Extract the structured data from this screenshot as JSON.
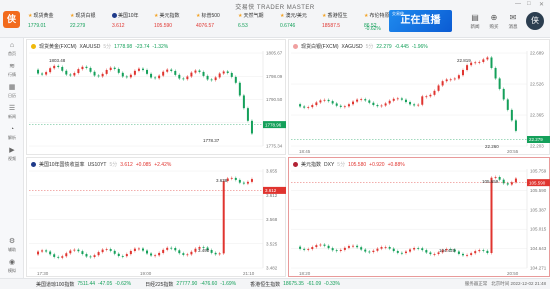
{
  "app": {
    "title": "交易侠 TRADER MASTER",
    "logo": "侠"
  },
  "window_controls": [
    "—",
    "□",
    "✕"
  ],
  "tickers": [
    {
      "name": "现货黄金",
      "value": "1779.01",
      "dir": "dn",
      "icon": "star-icon"
    },
    {
      "name": "现货白银",
      "value": "22.279",
      "dir": "dn",
      "icon": "star-icon"
    },
    {
      "name": "美国10年",
      "value": "3.612",
      "dir": "up",
      "icon": "us-flag-icon"
    },
    {
      "name": "美元指数",
      "value": "105.590",
      "dir": "up",
      "icon": "star-icon"
    },
    {
      "name": "标普500",
      "value": "4076.57",
      "dir": "up",
      "icon": "star-icon"
    },
    {
      "name": "天然气期",
      "value": "6.53",
      "dir": "dn",
      "icon": "star-icon"
    },
    {
      "name": "澳元/美元",
      "value": "0.6746",
      "dir": "dn",
      "icon": "star-icon"
    },
    {
      "name": "香港恒生",
      "value": "18587.5",
      "dir": "up",
      "icon": "star-icon"
    },
    {
      "name": "布伦特原油",
      "value": "86.52",
      "dir": "dn",
      "icon": "star-icon"
    },
    {
      "name": "",
      "value": "-0.62%",
      "dir": "dn",
      "icon": ""
    }
  ],
  "banner": {
    "main": "正在直播",
    "sub": "交易侠"
  },
  "top_icons": [
    {
      "name": "news-icon",
      "label": "新闻",
      "glyph": "▤"
    },
    {
      "name": "cart-icon",
      "label": "购买",
      "glyph": "⊕"
    },
    {
      "name": "message-icon",
      "label": "消息",
      "glyph": "✉"
    }
  ],
  "avatar": "侠",
  "sidebar": [
    {
      "icon": "home-icon",
      "glyph": "⌂",
      "label": "首页"
    },
    {
      "icon": "quotes-icon",
      "glyph": "≋",
      "label": "行情"
    },
    {
      "icon": "calendar-icon",
      "glyph": "▦",
      "label": "日历"
    },
    {
      "icon": "news-icon",
      "glyph": "☰",
      "label": "新闻"
    },
    {
      "icon": "analysis-icon",
      "glyph": "◔",
      "label": "解析"
    },
    {
      "icon": "video-icon",
      "glyph": "▶",
      "label": "视频"
    },
    {
      "icon": "tools-icon",
      "glyph": "⚙",
      "label": "辅助"
    },
    {
      "icon": "simulate-icon",
      "glyph": "◉",
      "label": "模拟"
    }
  ],
  "panels": [
    {
      "id": "gold",
      "name": "现货黄金(FXCM)",
      "symbol": "XAUUSD",
      "timeframe": "5分",
      "price": "1778.98",
      "change": "-23.74",
      "pct": "-1.32%",
      "dir": "dn",
      "flagcolor": "#f0b90b",
      "yticks": [
        "1805.67",
        "1798.09",
        "1790.50",
        "1782.92",
        "1775.34"
      ],
      "xticks": [],
      "last_label": "1778.96",
      "hi_label": "1803.48",
      "lo_label": "1778.37"
    },
    {
      "id": "silver",
      "name": "现货白银(FXCM)",
      "symbol": "XAGUSD",
      "timeframe": "5分",
      "price": "22.279",
      "change": "-0.445",
      "pct": "-1.96%",
      "dir": "dn",
      "flagcolor": "#c0c0c0",
      "yticks": [
        "22.689",
        "22.526",
        "22.365",
        "22.203"
      ],
      "xticks": [
        "18:45",
        "20:55"
      ],
      "last_label": "22.279",
      "hi_label": "22.819",
      "lo_label": "22.260"
    },
    {
      "id": "us10y",
      "name": "美国10年国债收益率",
      "symbol": "US10YT",
      "timeframe": "5分",
      "price": "3.612",
      "change": "+0.085",
      "pct": "+2.42%",
      "dir": "up",
      "flagcolor": "#1e3a8a",
      "yticks": [
        "3.655",
        "3.612",
        "3.568",
        "3.525",
        "3.482"
      ],
      "xticks": [
        "17:30",
        "19:00",
        "21:10"
      ],
      "last_label": "3.612",
      "hi_label": "3.638",
      "lo_label": "3.490"
    },
    {
      "id": "dxy",
      "name": "美元指数",
      "symbol": "DXY",
      "timeframe": "5分",
      "price": "105.580",
      "change": "+0.920",
      "pct": "+0.88%",
      "dir": "up",
      "flagcolor": "#b22234",
      "yticks": [
        "105.759",
        "105.590",
        "105.387",
        "105.015",
        "104.643",
        "104.271"
      ],
      "xticks": [
        "18:20",
        "20:50"
      ],
      "last_label": "105.590",
      "hi_label": "105.659",
      "lo_label": "104.420"
    }
  ],
  "bottom": [
    {
      "name": "美国道琼100指数",
      "value": "7511.44",
      "change": "-47.05",
      "pct": "-0.62%",
      "dir": "dn"
    },
    {
      "name": "日经225指数",
      "value": "27777.90",
      "change": "-476.60",
      "pct": "-1.69%",
      "dir": "dn"
    },
    {
      "name": "香港恒生指数",
      "value": "18675.35",
      "change": "-61.09",
      "pct": "-0.33%",
      "dir": "dn"
    }
  ],
  "status": {
    "server": "服务器正常",
    "time": "北京时间 2022-12-02 21:48"
  },
  "colors": {
    "up": "#e0342f",
    "down": "#14a05a",
    "last_tag_up": "#e0342f",
    "last_tag_down": "#14a05a"
  }
}
